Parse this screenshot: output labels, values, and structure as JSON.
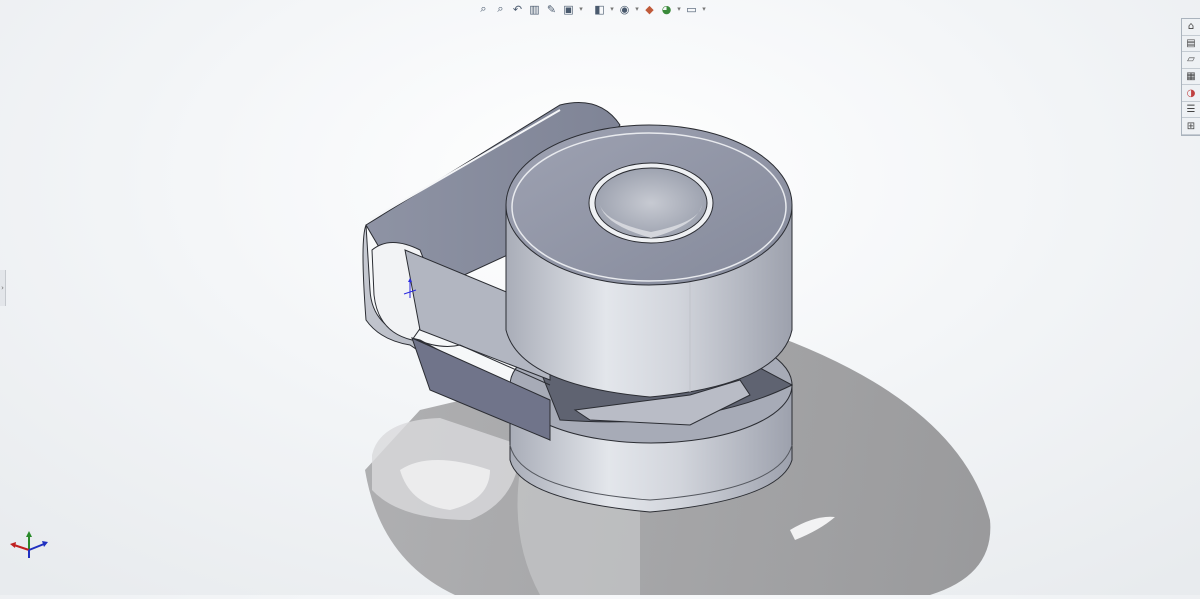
{
  "toolbar": {
    "items": [
      {
        "icon": "zoom-to-fit-icon",
        "glyph": "⌕"
      },
      {
        "icon": "zoom-to-area-icon",
        "glyph": "⌕"
      },
      {
        "icon": "previous-view-icon",
        "glyph": "↶"
      },
      {
        "icon": "section-view-icon",
        "glyph": "▥"
      },
      {
        "icon": "dynamic-annotation-icon",
        "glyph": "✎"
      },
      {
        "icon": "view-orientation-icon",
        "glyph": "▣"
      },
      {
        "icon": "display-style-icon",
        "glyph": "◧"
      },
      {
        "icon": "hide-show-items-icon",
        "glyph": "◉"
      },
      {
        "icon": "edit-appearance-icon",
        "glyph": "◆"
      },
      {
        "icon": "apply-scene-icon",
        "glyph": "◕"
      },
      {
        "icon": "view-settings-icon",
        "glyph": "▭"
      }
    ]
  },
  "task_pane": {
    "tabs": [
      {
        "icon": "home-icon",
        "glyph": "⌂"
      },
      {
        "icon": "design-library-icon",
        "glyph": "▤"
      },
      {
        "icon": "file-explorer-icon",
        "glyph": "▱"
      },
      {
        "icon": "view-palette-icon",
        "glyph": "▦"
      },
      {
        "icon": "appearances-icon",
        "glyph": "◑"
      },
      {
        "icon": "custom-properties-icon",
        "glyph": "☰"
      },
      {
        "icon": "solidworks-forum-icon",
        "glyph": "⊞"
      }
    ]
  },
  "colors": {
    "background_top": "#ffffff",
    "background_bottom": "#e8ebee",
    "part_face_light": "#c8ccd4",
    "part_face_dark": "#8e93a3",
    "part_edge": "#2b2d33",
    "shadow": "#8a8a8c"
  }
}
